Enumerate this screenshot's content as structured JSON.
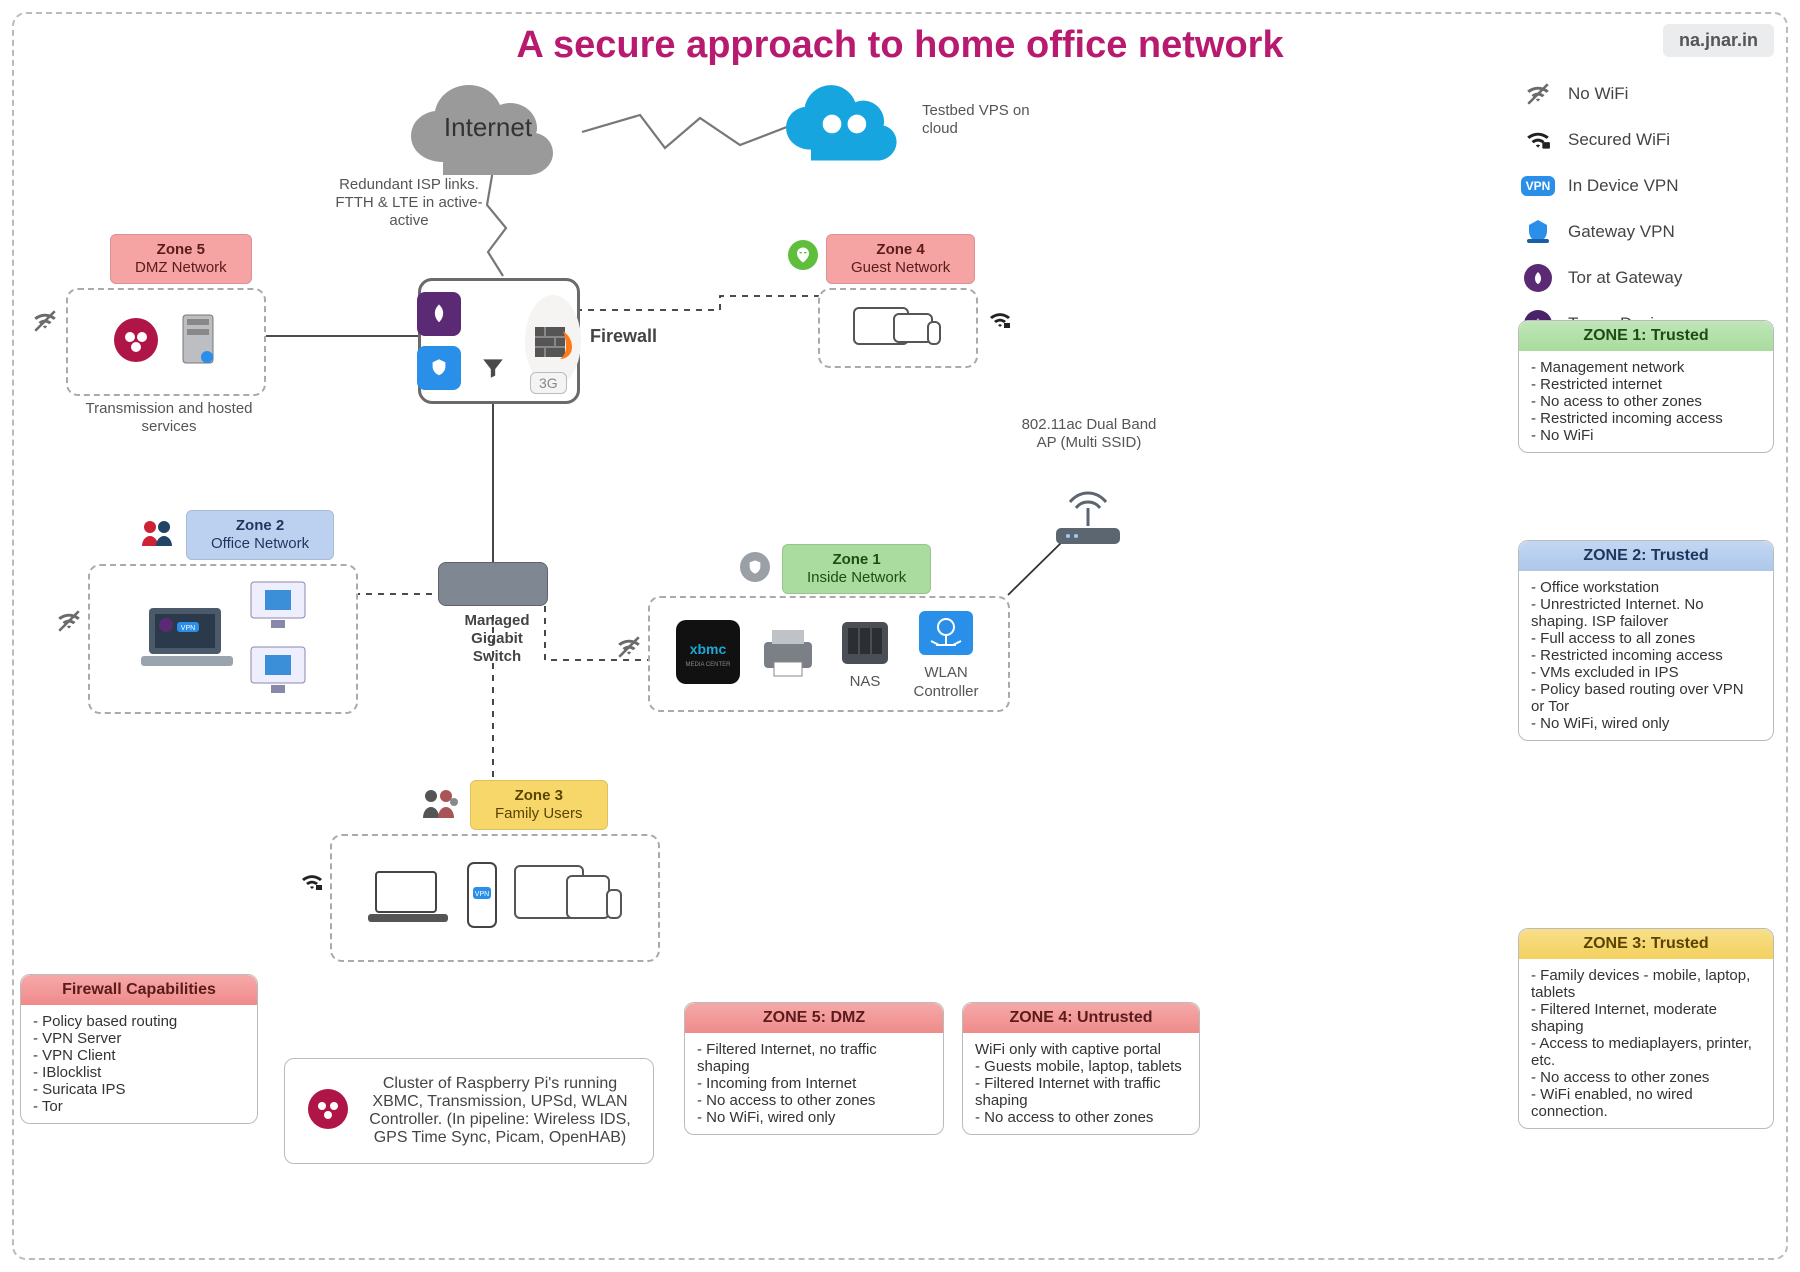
{
  "title": "A secure approach to home office network",
  "watermark": "na.jnar.in",
  "internet_label": "Internet",
  "internet_note": "Redundant ISP links. FTTH & LTE in active-active",
  "testbed_label": "Testbed VPS on cloud",
  "firewall_label": "Firewall",
  "firewall_3g": "3G",
  "switch_label": "Managed Gigabit Switch",
  "ap_label": "802.11ac Dual Band AP (Multi SSID)",
  "zones": {
    "z5": {
      "name": "Zone 5",
      "sub": "DMZ Network",
      "caption": "Transmission and hosted services"
    },
    "z4": {
      "name": "Zone 4",
      "sub": "Guest Network"
    },
    "z2": {
      "name": "Zone 2",
      "sub": "Office Network"
    },
    "z1": {
      "name": "Zone 1",
      "sub": "Inside Network",
      "nas": "NAS",
      "wlan": "WLAN Controller",
      "xbmc": "xbmc"
    },
    "z3": {
      "name": "Zone 3",
      "sub": "Family Users"
    }
  },
  "raspberry_note": "Cluster of Raspberry Pi's running XBMC, Transmission, UPSd, WLAN Controller. (In pipeline: Wireless IDS, GPS Time Sync, Picam, OpenHAB)",
  "legend": {
    "no_wifi": "No WiFi",
    "secured_wifi": "Secured WiFi",
    "in_device_vpn": "In Device VPN",
    "gateway_vpn": "Gateway VPN",
    "tor_gw": "Tor at Gateway",
    "tor_dev": "Tor on Device"
  },
  "cards": {
    "fwcap": {
      "title": "Firewall Capabilities",
      "items": [
        "Policy based routing",
        "VPN Server",
        "VPN Client",
        "IBlocklist",
        "Suricata IPS",
        "Tor"
      ]
    },
    "z1": {
      "title": "ZONE 1: Trusted",
      "items": [
        "Management network",
        "Restricted internet",
        "No acess to other zones",
        "Restricted incoming access",
        "No WiFi"
      ]
    },
    "z2": {
      "title": "ZONE 2: Trusted",
      "items": [
        "Office workstation",
        "Unrestricted Internet. No shaping. ISP failover",
        "Full access to all zones",
        "Restricted incoming access",
        "VMs excluded in IPS",
        "Policy based routing over VPN or Tor",
        "No WiFi, wired only"
      ]
    },
    "z3": {
      "title": "ZONE 3: Trusted",
      "items": [
        "Family devices - mobile, laptop, tablets",
        "Filtered Internet, moderate shaping",
        "Access to mediaplayers, printer, etc.",
        "No access to other zones",
        "WiFi enabled, no wired connection."
      ]
    },
    "z4": {
      "title": "ZONE 4: Untrusted",
      "body": "WiFi only with captive portal\n- Guests mobile, laptop, tablets\n- Filtered Internet with traffic shaping\n- No access to other zones"
    },
    "z5": {
      "title": "ZONE 5: DMZ",
      "items": [
        "Filtered Internet, no traffic shaping",
        "Incoming from Internet",
        "No access to other zones",
        "No WiFi, wired only"
      ]
    }
  }
}
